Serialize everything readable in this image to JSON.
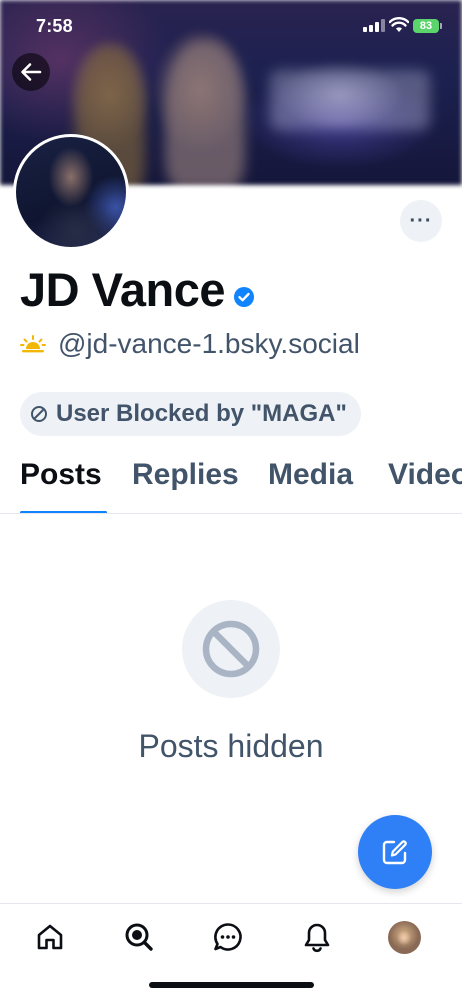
{
  "status_bar": {
    "time": "7:58",
    "battery": "83"
  },
  "profile": {
    "display_name": "JD Vance",
    "handle": "@jd-vance-1.bsky.social",
    "handle_emoji": "sun-emoji",
    "blocked_label": "User Blocked by \"MAGA\"",
    "more_label": "···"
  },
  "tabs": [
    {
      "label": "Posts",
      "active": true
    },
    {
      "label": "Replies",
      "active": false
    },
    {
      "label": "Media",
      "active": false
    },
    {
      "label": "Videos",
      "active": false
    }
  ],
  "empty_state": {
    "icon": "ban-icon",
    "text": "Posts hidden"
  },
  "bottom_nav": {
    "items": [
      "home-icon",
      "search-icon",
      "chat-icon",
      "bell-icon",
      "profile-avatar"
    ]
  },
  "colors": {
    "accent": "#1083fe",
    "fab": "#2f80f6",
    "muted_text": "#42546a",
    "pill_bg": "#eef1f5",
    "verified": "#1083fe"
  }
}
